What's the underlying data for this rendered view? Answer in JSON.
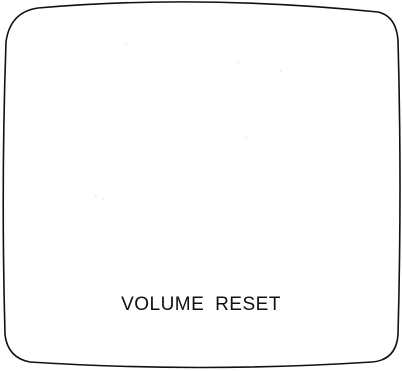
{
  "screen": {
    "osd_message": "VOLUME RESET"
  },
  "colors": {
    "outline": "#111111",
    "background": "#ffffff",
    "text": "#111111"
  }
}
